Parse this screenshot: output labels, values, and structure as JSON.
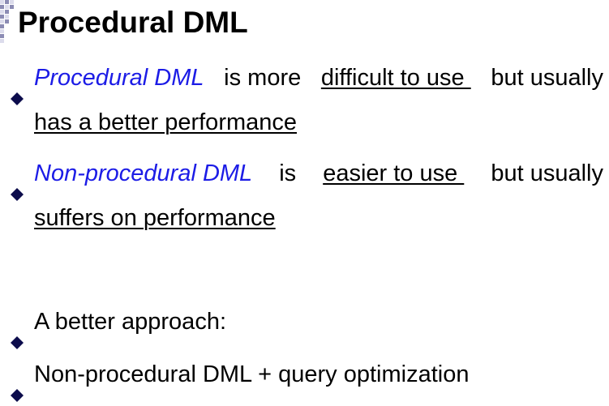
{
  "slide": {
    "title": "Procedural DML",
    "colors": {
      "emphasis": "#1c1ce6",
      "text": "#000000",
      "deco_light": "#dcdcec",
      "deco_dark": "#8c8cb4"
    },
    "marker_icon": "diamond-bullet-icon",
    "bullets": [
      {
        "term": "Procedural DML",
        "mid": "is more",
        "underlined": "difficult to use ",
        "tail": "but usually",
        "continuation": "has a better performance"
      },
      {
        "term": "Non-procedural DML",
        "mid": "is",
        "underlined": "easier to use ",
        "tail": "but usually",
        "continuation": "suffers on performance"
      },
      {
        "text": "A better approach:"
      },
      {
        "text": "Non-procedural DML + query optimization"
      }
    ]
  }
}
